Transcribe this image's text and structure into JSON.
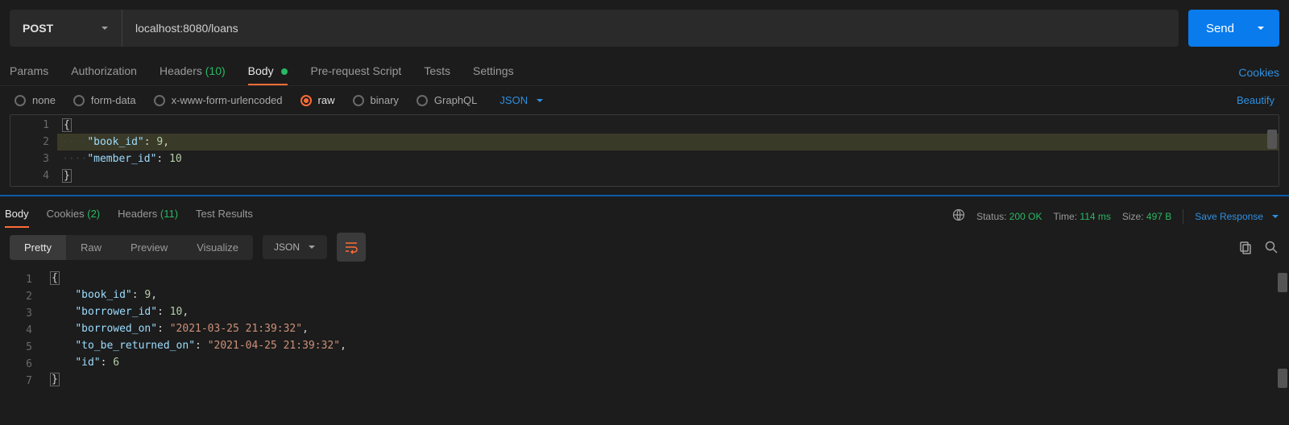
{
  "request": {
    "method": "POST",
    "url": "localhost:8080/loans",
    "send_label": "Send"
  },
  "req_tabs": {
    "params": "Params",
    "auth": "Authorization",
    "headers_label": "Headers",
    "headers_count": "(10)",
    "body": "Body",
    "prerequest": "Pre-request Script",
    "tests": "Tests",
    "settings": "Settings",
    "cookies": "Cookies"
  },
  "body_types": {
    "none": "none",
    "formdata": "form-data",
    "xwww": "x-www-form-urlencoded",
    "raw": "raw",
    "binary": "binary",
    "graphql": "GraphQL",
    "json": "JSON",
    "beautify": "Beautify"
  },
  "request_body_lines": [
    "1",
    "2",
    "3",
    "4"
  ],
  "request_body": {
    "book_id": 9,
    "member_id": 10
  },
  "resp_tabs": {
    "body": "Body",
    "cookies_label": "Cookies",
    "cookies_count": "(2)",
    "headers_label": "Headers",
    "headers_count": "(11)",
    "test_results": "Test Results"
  },
  "resp_status": {
    "status_label": "Status:",
    "status_value": "200 OK",
    "time_label": "Time:",
    "time_value": "114 ms",
    "size_label": "Size:",
    "size_value": "497 B",
    "save_label": "Save Response"
  },
  "view_modes": {
    "pretty": "Pretty",
    "raw": "Raw",
    "preview": "Preview",
    "visualize": "Visualize",
    "format": "JSON"
  },
  "response_body_lines": [
    "1",
    "2",
    "3",
    "4",
    "5",
    "6",
    "7"
  ],
  "response_body": {
    "book_id": 9,
    "borrower_id": 10,
    "borrowed_on": "2021-03-25 21:39:32",
    "to_be_returned_on": "2021-04-25 21:39:32",
    "id": 6
  }
}
